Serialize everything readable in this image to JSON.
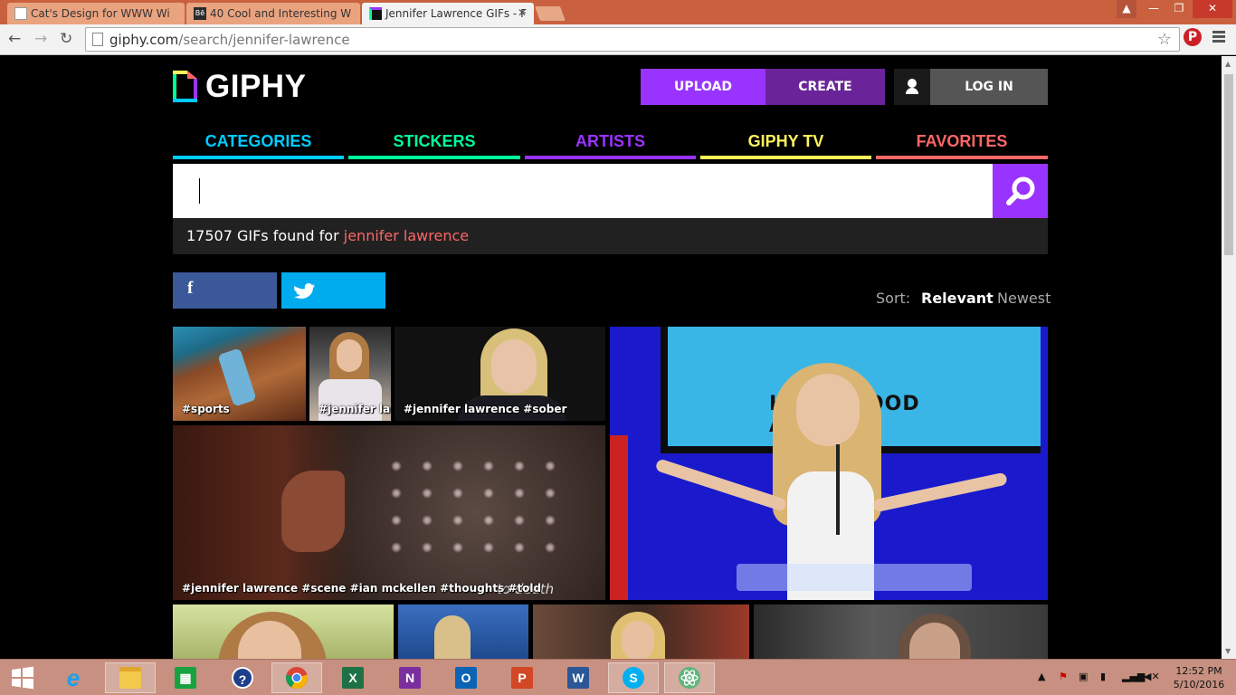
{
  "browser": {
    "tabs": [
      {
        "title": "Cat's Design for WWW Wi",
        "favicon_color": "#ffffff"
      },
      {
        "title": "40 Cool and Interesting W",
        "favicon_color": "#2b2b2b"
      },
      {
        "title": "Jennifer Lawrence GIFs - F",
        "favicon_color": "#111111"
      }
    ],
    "url_host": "giphy.com",
    "url_path": "/search/jennifer-lawrence",
    "pinterest_label": "P"
  },
  "header": {
    "logo_text": "GIPHY",
    "upload_label": "UPLOAD",
    "create_label": "CREATE",
    "login_label": "LOG IN"
  },
  "nav": [
    {
      "label": "CATEGORIES",
      "color": "#00ccff"
    },
    {
      "label": "STICKERS",
      "color": "#00ff99"
    },
    {
      "label": "ARTISTS",
      "color": "#9933ff"
    },
    {
      "label": "GIPHY TV",
      "color": "#fff35c"
    },
    {
      "label": "FAVORITES",
      "color": "#ff6666"
    }
  ],
  "search": {
    "value": "",
    "placeholder": ""
  },
  "results": {
    "count_text": "17507 GIFs found for",
    "query": "jennifer lawrence"
  },
  "share": {
    "facebook_icon": "f",
    "twitter_icon": "twitter-bird"
  },
  "sort": {
    "label": "Sort:",
    "relevant": "Relevant",
    "newest": "Newest"
  },
  "gifs": [
    {
      "tags": "#sports"
    },
    {
      "tags": "#jennifer law"
    },
    {
      "tags": "#jennifer lawrence #sober"
    },
    {
      "tags": "#jennifer lawrence #scene #ian mckellen #thoughts #told",
      "caption": "to death"
    },
    {
      "tags": "",
      "caption": "HOLLYWOOD AWARDS"
    },
    {
      "tags": ""
    },
    {
      "tags": ""
    },
    {
      "tags": ""
    },
    {
      "tags": ""
    }
  ],
  "taskbar": {
    "apps": [
      "start",
      "internet-explorer",
      "file-explorer",
      "store",
      "help",
      "chrome",
      "excel",
      "onenote",
      "outlook",
      "powerpoint",
      "word",
      "skype",
      "atom"
    ],
    "app_letters": {
      "excel": "X",
      "onenote": "N",
      "outlook": "O",
      "powerpoint": "P",
      "word": "W",
      "skype": "S"
    },
    "time": "12:52 PM",
    "date": "5/10/2016"
  },
  "colors": {
    "giphy_purple": "#9933ff",
    "giphy_dark_purple": "#6a2399",
    "facebook": "#3b5998",
    "twitter": "#00acee",
    "query_red": "#ff6666"
  }
}
